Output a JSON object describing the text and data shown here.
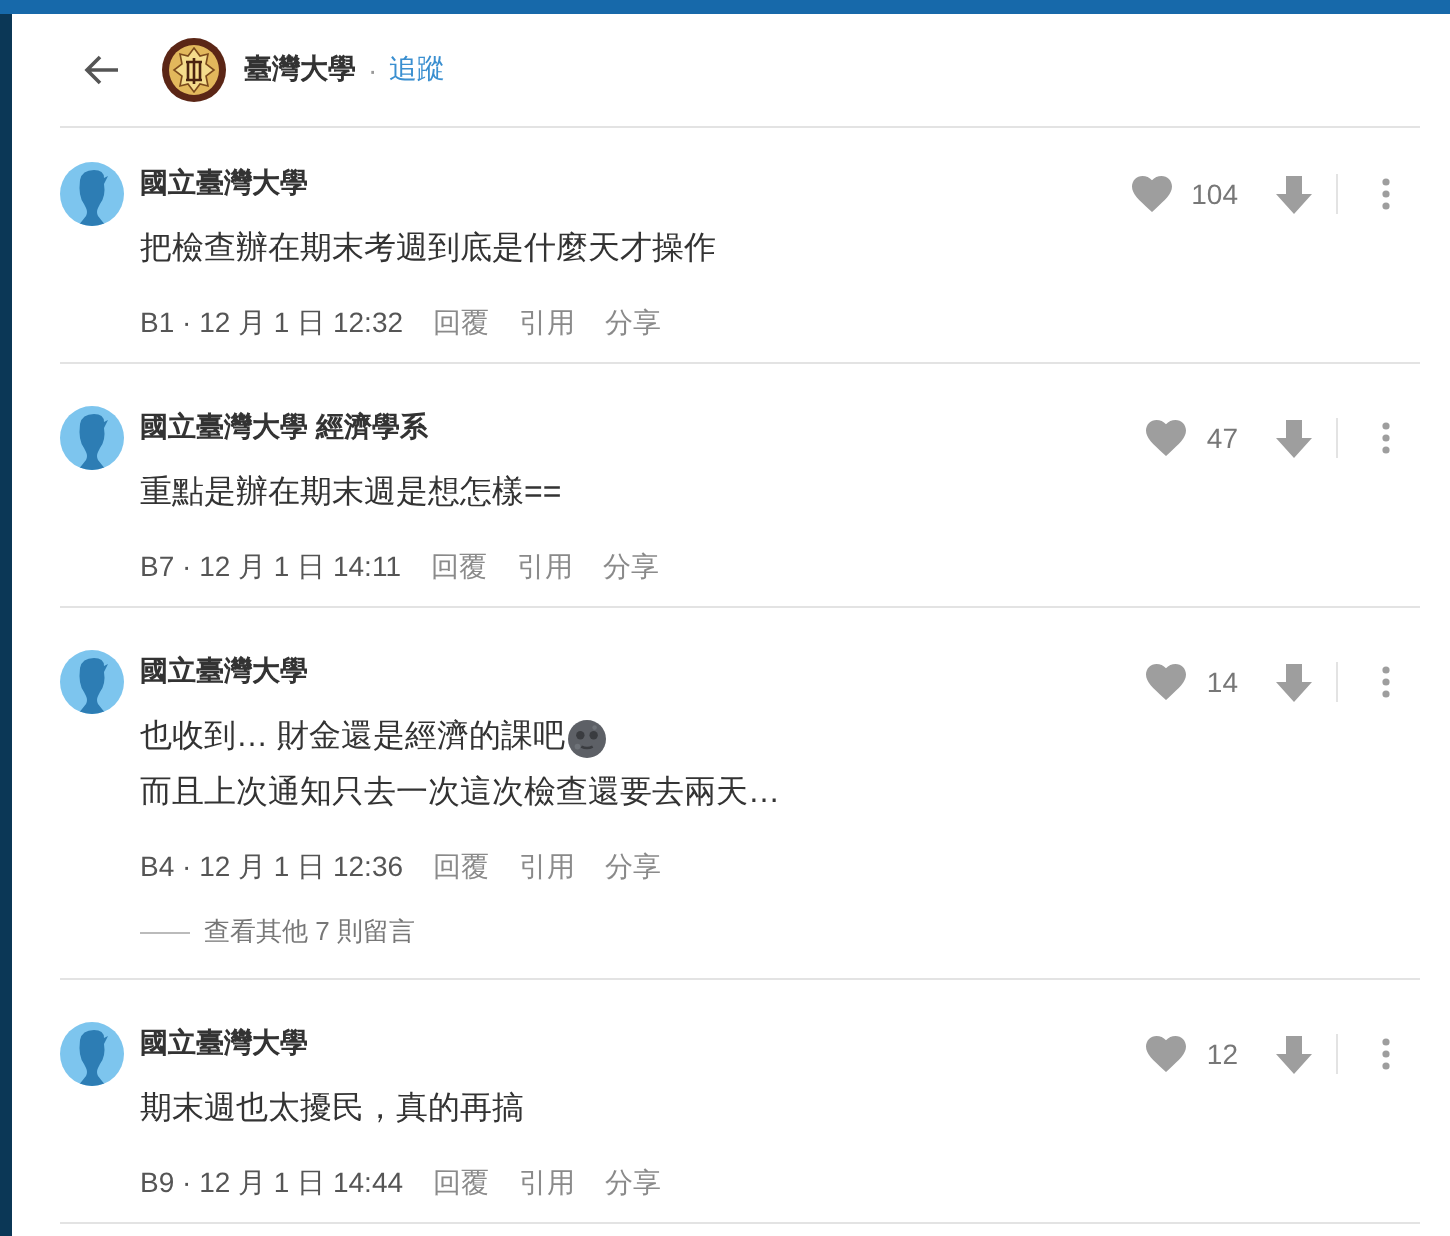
{
  "header": {
    "title": "臺灣大學",
    "separator": "·",
    "follow": "追蹤"
  },
  "comments": [
    {
      "author": "國立臺灣大學",
      "body": [
        {
          "text": "把檢查辦在期末考週到底是什麼天才操作",
          "icon": false
        }
      ],
      "likes": "104",
      "meta": "B1 · 12 月 1 日 12:32",
      "actions": [
        "回覆",
        "引用",
        "分享"
      ]
    },
    {
      "author": "國立臺灣大學 經濟學系",
      "body": [
        {
          "text": "重點是辦在期末週是想怎樣==",
          "icon": false
        }
      ],
      "likes": "47",
      "meta": "B7 · 12 月 1 日 14:11",
      "actions": [
        "回覆",
        "引用",
        "分享"
      ]
    },
    {
      "author": "國立臺灣大學",
      "body": [
        {
          "text": "也收到… 財金還是經濟的課吧",
          "icon": true
        },
        {
          "text": "而且上次通知只去一次這次檢查還要去兩天…",
          "icon": false
        }
      ],
      "likes": "14",
      "meta": "B4 · 12 月 1 日 12:36",
      "actions": [
        "回覆",
        "引用",
        "分享"
      ],
      "more_replies": "查看其他 7 則留言"
    },
    {
      "author": "國立臺灣大學",
      "body": [
        {
          "text": "期末週也太擾民，真的再搞",
          "icon": false
        }
      ],
      "likes": "12",
      "meta": "B9 · 12 月 1 日 14:44",
      "actions": [
        "回覆",
        "引用",
        "分享"
      ]
    }
  ]
}
